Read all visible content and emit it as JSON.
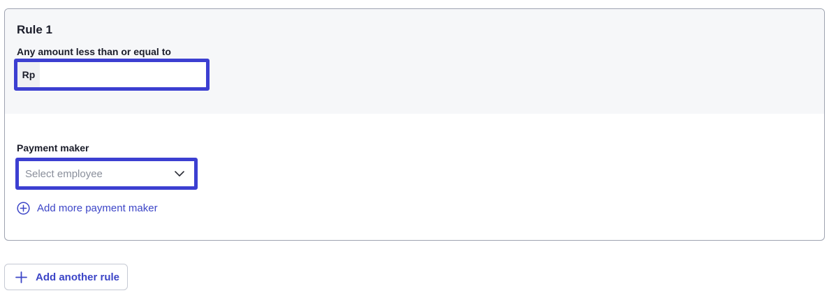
{
  "rule": {
    "title": "Rule 1",
    "amount_label": "Any amount less than or equal to",
    "currency_prefix": "Rp",
    "amount_value": "",
    "amount_placeholder": ""
  },
  "payment_maker": {
    "label": "Payment maker",
    "select_placeholder": "Select employee",
    "add_more_label": "Add more payment maker"
  },
  "add_rule_label": "Add another rule",
  "colors": {
    "accent": "#3c45c7",
    "focus_outline": "#3c3fd1",
    "card_top_bg": "#f6f7f9"
  },
  "icons": {
    "select_chevron": "chevron-down-icon",
    "add_maker": "plus-circle-icon",
    "add_rule": "plus-icon"
  }
}
